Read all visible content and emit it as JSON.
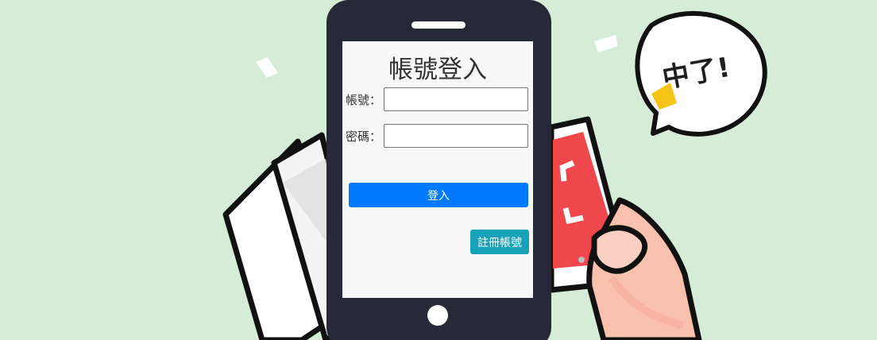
{
  "login": {
    "title": "帳號登入",
    "account_label": "帳號：",
    "account_value": "",
    "password_label": "密碼：",
    "password_value": "",
    "login_button": "登入",
    "register_button": "註冊帳號"
  },
  "illustration": {
    "bubble_text": "中了!"
  },
  "colors": {
    "background": "#d5ecd7",
    "phone_body": "#272838",
    "primary_button": "#007bff",
    "register_button": "#17a2b8",
    "ticket_red": "#f0474c"
  }
}
